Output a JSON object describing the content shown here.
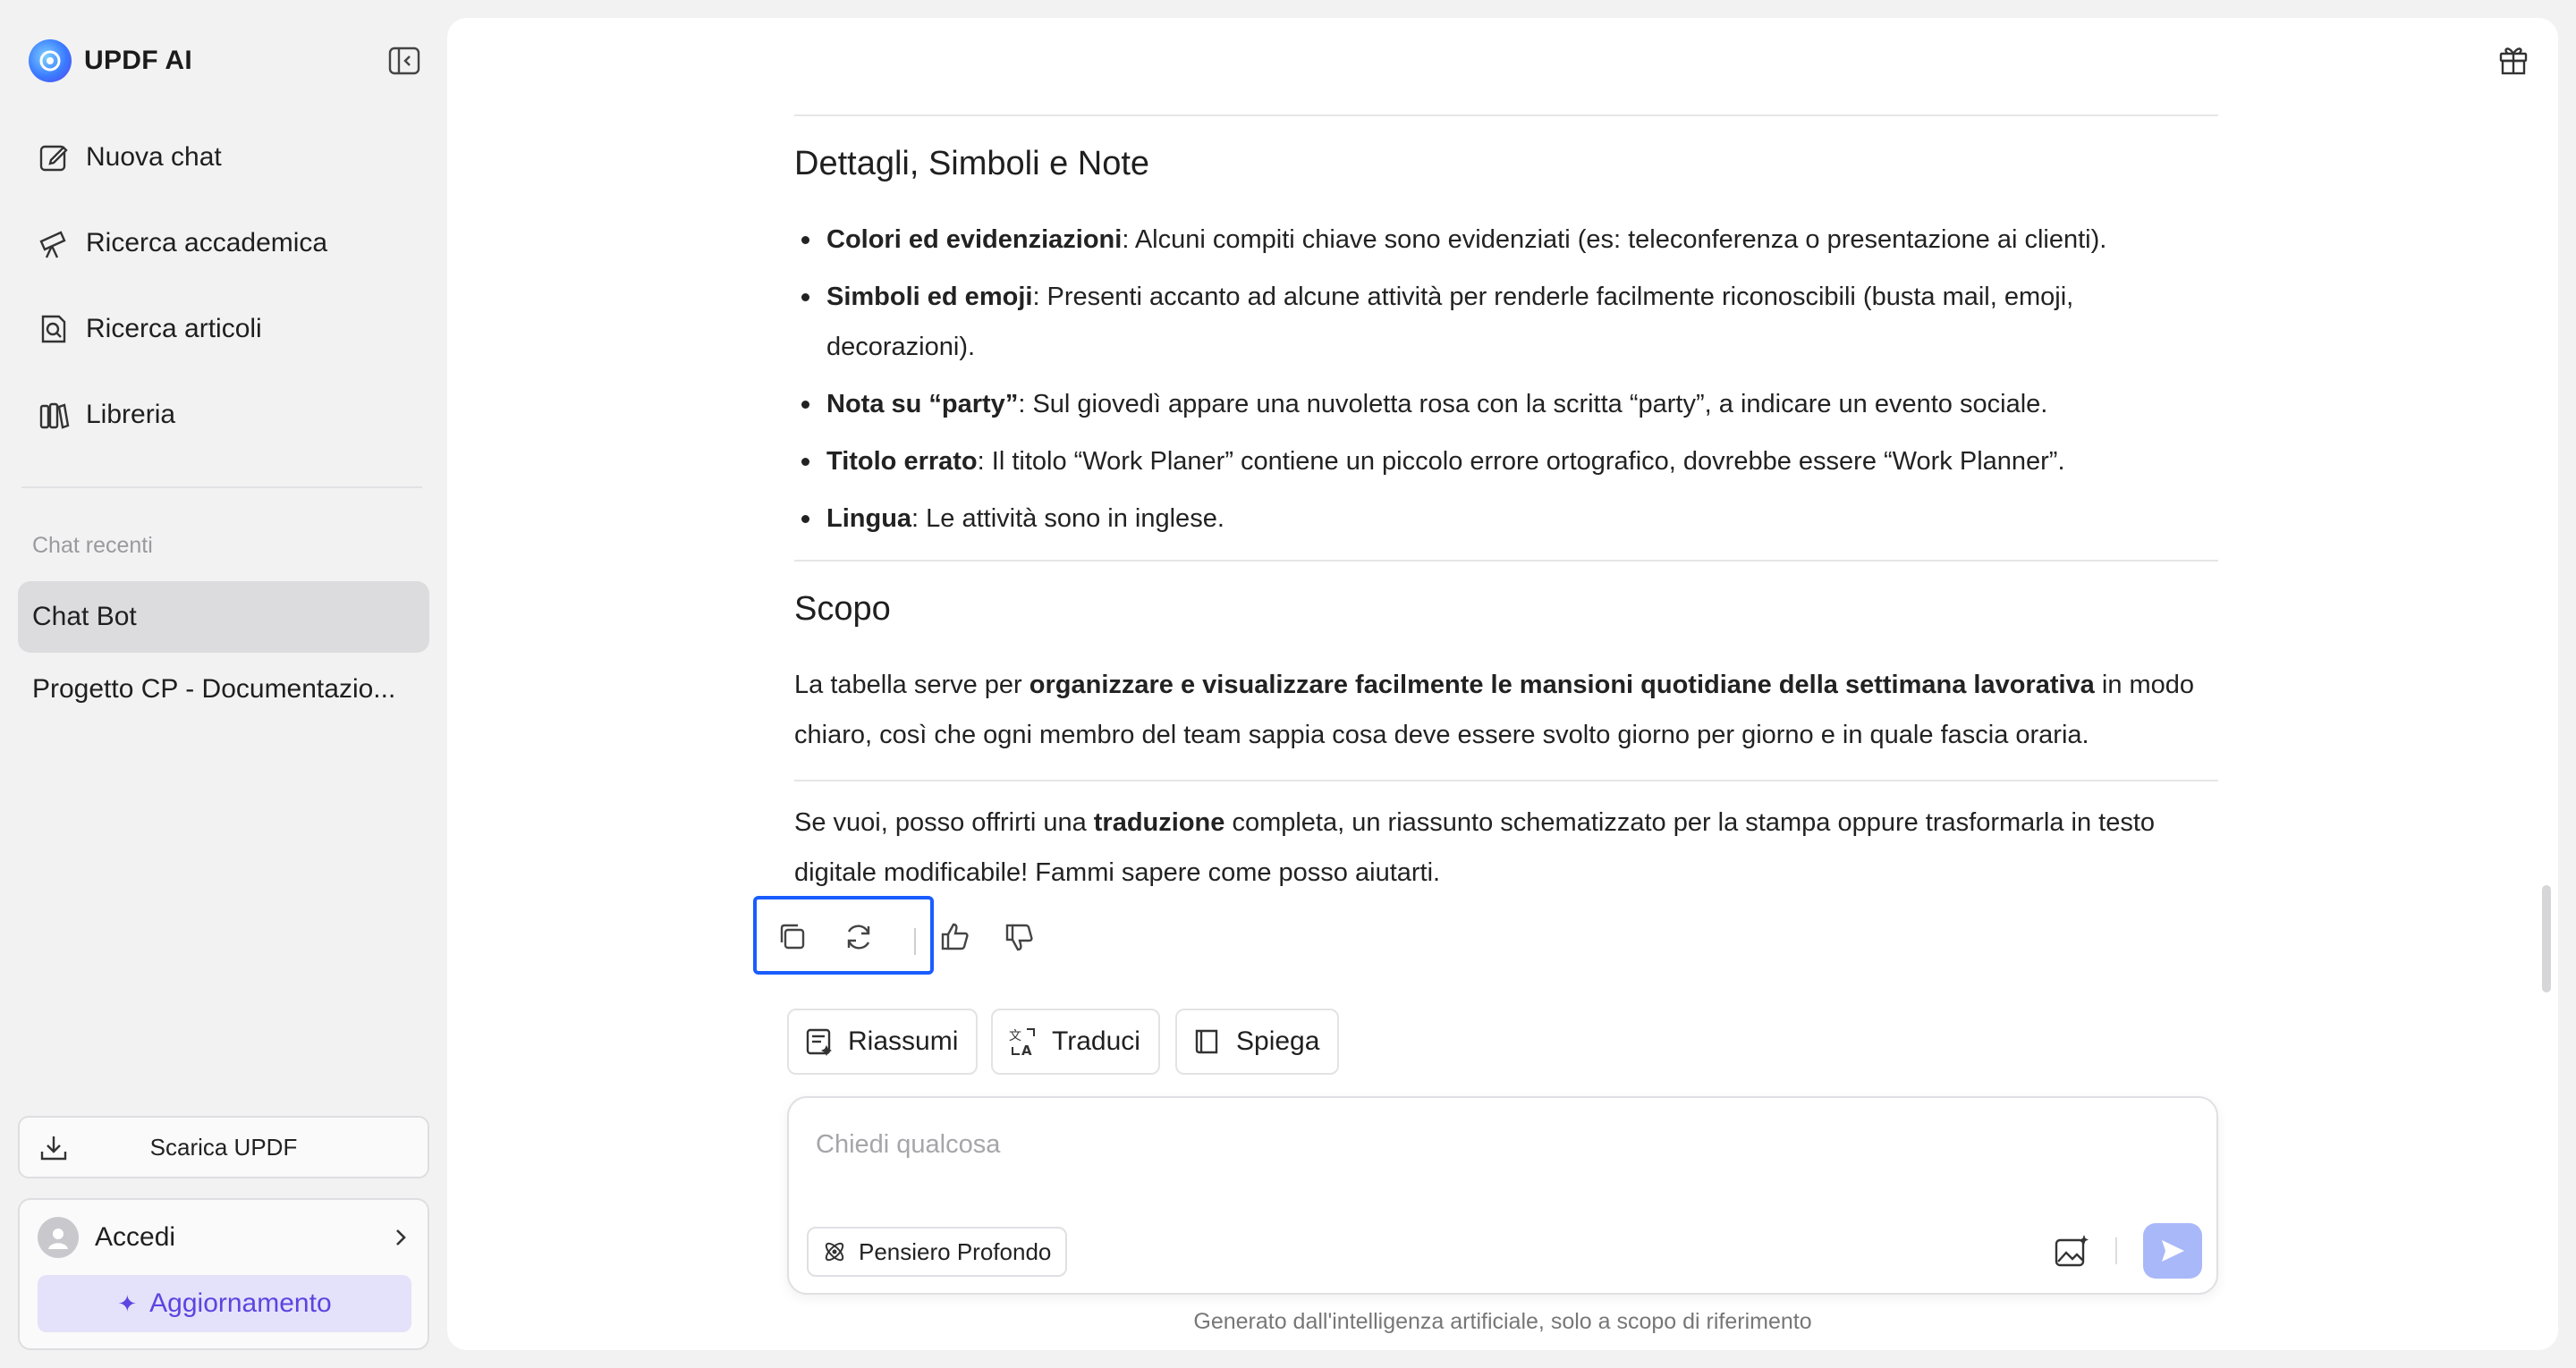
{
  "brand": {
    "name": "UPDF AI"
  },
  "sidebar": {
    "nav": [
      {
        "label": "Nuova chat",
        "icon": "edit-icon"
      },
      {
        "label": "Ricerca accademica",
        "icon": "telescope-icon"
      },
      {
        "label": "Ricerca articoli",
        "icon": "search-document-icon"
      },
      {
        "label": "Libreria",
        "icon": "library-icon"
      }
    ],
    "recent_title": "Chat recenti",
    "recent": [
      {
        "label": "Chat Bot",
        "active": true
      },
      {
        "label": "Progetto CP - Documentazio...",
        "active": false
      }
    ],
    "download_label": "Scarica UPDF",
    "account_label": "Accedi",
    "upgrade_label": "Aggiornamento"
  },
  "message": {
    "section1_title": "Dettagli, Simboli e Note",
    "bullets": [
      {
        "bold": "Colori ed evidenziazioni",
        "text": ": Alcuni compiti chiave sono evidenziati (es: teleconferenza o presentazione ai clienti)."
      },
      {
        "bold": "Simboli ed emoji",
        "text": ": Presenti accanto ad alcune attività per renderle facilmente riconoscibili (busta mail, emoji, decorazioni)."
      },
      {
        "bold": "Nota su “party”",
        "text": ": Sul giovedì appare una nuvoletta rosa con la scritta “party”, a indicare un evento sociale."
      },
      {
        "bold": "Titolo errato",
        "text": ": Il titolo “Work Planer” contiene un piccolo errore ortografico, dovrebbe essere “Work Planner”."
      },
      {
        "bold": "Lingua",
        "text": ": Le attività sono in inglese."
      }
    ],
    "section2_title": "Scopo",
    "scopo": {
      "pre": "La tabella serve per ",
      "bold": "organizzare e visualizzare facilmente le mansioni quotidiane della settimana lavorativa",
      "post": " in modo chiaro, così che ogni membro del team sappia cosa deve essere svolto giorno per giorno e in quale fascia oraria."
    },
    "closing": {
      "pre": "Se vuoi, posso offrirti una ",
      "bold": "traduzione",
      "post": " completa, un riassunto schematizzato per la stampa oppure trasformarla in testo digitale modificabile! Fammi sapere come posso aiutarti."
    }
  },
  "quick_actions": {
    "summarize": "Riassumi",
    "translate": "Traduci",
    "explain": "Spiega"
  },
  "composer": {
    "placeholder": "Chiedi qualcosa",
    "deep_thinking": "Pensiero Profondo"
  },
  "footer_note": "Generato dall'intelligenza artificiale, solo a scopo di riferimento",
  "colors": {
    "accent": "#1a5cff",
    "upgrade_text": "#5b45e0",
    "send_disabled": "#a9b8f9"
  }
}
